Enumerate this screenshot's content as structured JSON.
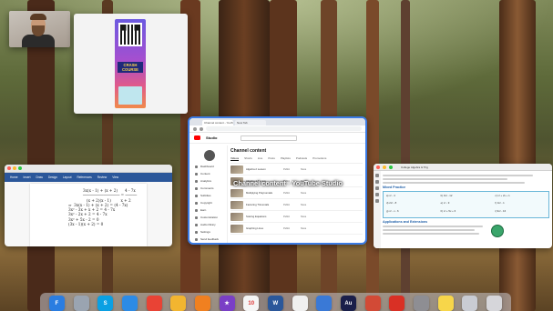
{
  "studio": {
    "window_label": "Channel content - YouTube Studio",
    "tabs": [
      "Channel content - YouTube Studio",
      "New Tab"
    ],
    "logo_text": "Studio",
    "search_placeholder": "Search across your channel",
    "channel_name": "Your channel",
    "sidebar": [
      "Dashboard",
      "Content",
      "Analytics",
      "Comments",
      "Subtitles",
      "Copyright",
      "Earn",
      "Customization",
      "Audio library",
      "Settings",
      "Send feedback"
    ],
    "page_title": "Channel content",
    "content_tabs": [
      "Videos",
      "Shorts",
      "Live",
      "Posts",
      "Playlists",
      "Podcasts",
      "Promotions"
    ],
    "rows": [
      {
        "title": "Algebra 2 Lesson",
        "visibility": "Public",
        "restrictions": "None"
      },
      {
        "title": "Algebra 1 Review",
        "visibility": "Public",
        "restrictions": "None"
      },
      {
        "title": "Multiplying Polynomials",
        "visibility": "Public",
        "restrictions": "None"
      },
      {
        "title": "Factoring Trinomials",
        "visibility": "Public",
        "restrictions": "None"
      },
      {
        "title": "Solving Equations",
        "visibility": "Public",
        "restrictions": "None"
      },
      {
        "title": "Graphing Lines",
        "visibility": "Public",
        "restrictions": "None"
      }
    ]
  },
  "word": {
    "ribbon": [
      "Home",
      "Insert",
      "Draw",
      "Design",
      "Layout",
      "References",
      "Review",
      "View"
    ],
    "equations": [
      "3x(x - 1) + (x + 2)      4 - 7x",
      "──────────────── = ─────",
      "   (x + 2)(x - 1)        x + 2",
      "⇒  3x(x - 1) + (x + 2) = (4 - 7x)",
      "3x² - 3x + x + 2 = 4 - 7x",
      "3x² - 2x + 2 = 4 - 7x",
      "3x² + 5x - 2 = 0",
      "(3x - 1)(x + 2) = 0"
    ]
  },
  "pdf": {
    "title": "College Algebra & Trig",
    "headings": [
      "Mixed Practice",
      "Applications and Extensions"
    ],
    "problems": [
      "a) x² - 4",
      "b) 3x² - 12",
      "c) x² + 2x + 1",
      "d) 2x² - 8",
      "e) x² - 9",
      "f) 4x² - 1",
      "g) x² - x - 6",
      "h) x² + 5x + 6",
      "i) 9x² - 16"
    ]
  },
  "dock": [
    {
      "name": "finder-icon",
      "label": "F",
      "color": "#2a7de1"
    },
    {
      "name": "launchpad-icon",
      "label": "",
      "color": "#9aa4b1"
    },
    {
      "name": "skype-icon",
      "label": "S",
      "color": "#0aa0e3"
    },
    {
      "name": "safari-icon",
      "label": "",
      "color": "#2c8be6"
    },
    {
      "name": "chrome-icon",
      "label": "",
      "color": "#e94335"
    },
    {
      "name": "photos-icon",
      "label": "",
      "color": "#f2b530"
    },
    {
      "name": "vlc-icon",
      "label": "",
      "color": "#f08020"
    },
    {
      "name": "imovie-icon",
      "label": "★",
      "color": "#7a3fc6"
    },
    {
      "name": "calendar-icon",
      "label": "10",
      "color": "#f5f5f5"
    },
    {
      "name": "word-icon",
      "label": "W",
      "color": "#2b579a"
    },
    {
      "name": "pages-icon",
      "label": "",
      "color": "#f0f0f0"
    },
    {
      "name": "keynote-icon",
      "label": "",
      "color": "#3a79d6"
    },
    {
      "name": "audition-icon",
      "label": "Au",
      "color": "#1a1f4a"
    },
    {
      "name": "preview-icon",
      "label": "",
      "color": "#d24a36"
    },
    {
      "name": "acrobat-icon",
      "label": "",
      "color": "#d93025"
    },
    {
      "name": "settings-icon",
      "label": "",
      "color": "#8e8e93"
    },
    {
      "name": "notes-icon",
      "label": "",
      "color": "#f7d64a"
    },
    {
      "name": "files-icon",
      "label": "",
      "color": "#c9ccd3"
    },
    {
      "name": "trash-icon",
      "label": "",
      "color": "#d6d6da"
    }
  ]
}
